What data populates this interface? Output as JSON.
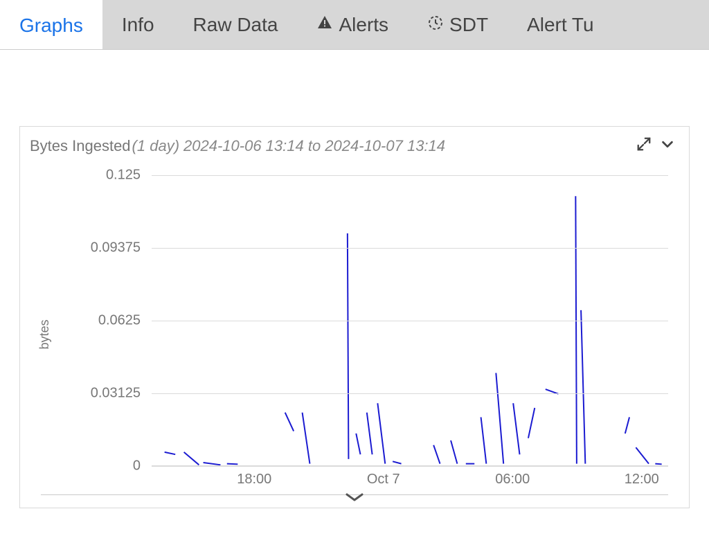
{
  "tabs": [
    {
      "label": "Graphs",
      "active": true
    },
    {
      "label": "Info"
    },
    {
      "label": "Raw Data"
    },
    {
      "label": "Alerts",
      "icon": "alert-triangle-icon"
    },
    {
      "label": "SDT",
      "icon": "clock-icon"
    },
    {
      "label": "Alert Tu"
    }
  ],
  "panel": {
    "title": "Bytes Ingested",
    "subtitle": "(1 day)",
    "range": "2024-10-06 13:14 to 2024-10-07 13:14"
  },
  "chart_data": {
    "type": "line",
    "title": "Bytes Ingested",
    "ylabel": "bytes",
    "xlabel": "",
    "ylim": [
      0,
      0.125
    ],
    "y_ticks": [
      0,
      0.03125,
      0.0625,
      0.09375,
      0.125
    ],
    "x_ticks": [
      {
        "t": 4.77,
        "label": "18:00"
      },
      {
        "t": 10.77,
        "label": "Oct 7"
      },
      {
        "t": 16.77,
        "label": "06:00"
      },
      {
        "t": 22.77,
        "label": "12:00"
      }
    ],
    "x_range_hours": [
      0,
      24
    ],
    "series": [
      {
        "name": "bytes",
        "color": "#1b1bd1",
        "segments": [
          [
            [
              0.6,
              0.006
            ],
            [
              1.1,
              0.005
            ]
          ],
          [
            [
              1.5,
              0.006
            ],
            [
              2.2,
              0.0005
            ]
          ],
          [
            [
              2.4,
              0.0015
            ],
            [
              3.2,
              0.0005
            ]
          ],
          [
            [
              3.5,
              0.001
            ],
            [
              4.0,
              0.0008
            ]
          ],
          [
            [
              6.2,
              0.023
            ],
            [
              6.6,
              0.015
            ]
          ],
          [
            [
              7.0,
              0.023
            ],
            [
              7.35,
              0.001
            ]
          ],
          [
            [
              9.1,
              0.1
            ],
            [
              9.15,
              0.003
            ]
          ],
          [
            [
              9.5,
              0.014
            ],
            [
              9.7,
              0.005
            ]
          ],
          [
            [
              10.0,
              0.023
            ],
            [
              10.25,
              0.005
            ]
          ],
          [
            [
              10.5,
              0.027
            ],
            [
              10.85,
              0.001
            ]
          ],
          [
            [
              11.2,
              0.002
            ],
            [
              11.6,
              0.001
            ]
          ],
          [
            [
              13.1,
              0.009
            ],
            [
              13.4,
              0.001
            ]
          ],
          [
            [
              13.9,
              0.011
            ],
            [
              14.2,
              0.001
            ]
          ],
          [
            [
              14.6,
              0.001
            ],
            [
              15.0,
              0.001
            ]
          ],
          [
            [
              15.3,
              0.021
            ],
            [
              15.55,
              0.001
            ]
          ],
          [
            [
              16.0,
              0.04
            ],
            [
              16.35,
              0.001
            ]
          ],
          [
            [
              16.8,
              0.027
            ],
            [
              17.1,
              0.005
            ]
          ],
          [
            [
              17.5,
              0.012
            ],
            [
              17.8,
              0.025
            ]
          ],
          [
            [
              18.3,
              0.033
            ],
            [
              18.9,
              0.031
            ]
          ],
          [
            [
              19.7,
              0.116
            ],
            [
              19.75,
              0.001
            ]
          ],
          [
            [
              19.95,
              0.067
            ],
            [
              20.15,
              0.001
            ]
          ],
          [
            [
              22.0,
              0.014
            ],
            [
              22.2,
              0.021
            ]
          ],
          [
            [
              22.5,
              0.008
            ],
            [
              23.1,
              0.001
            ]
          ],
          [
            [
              23.4,
              0.001
            ],
            [
              23.7,
              0.0008
            ]
          ]
        ]
      }
    ]
  }
}
